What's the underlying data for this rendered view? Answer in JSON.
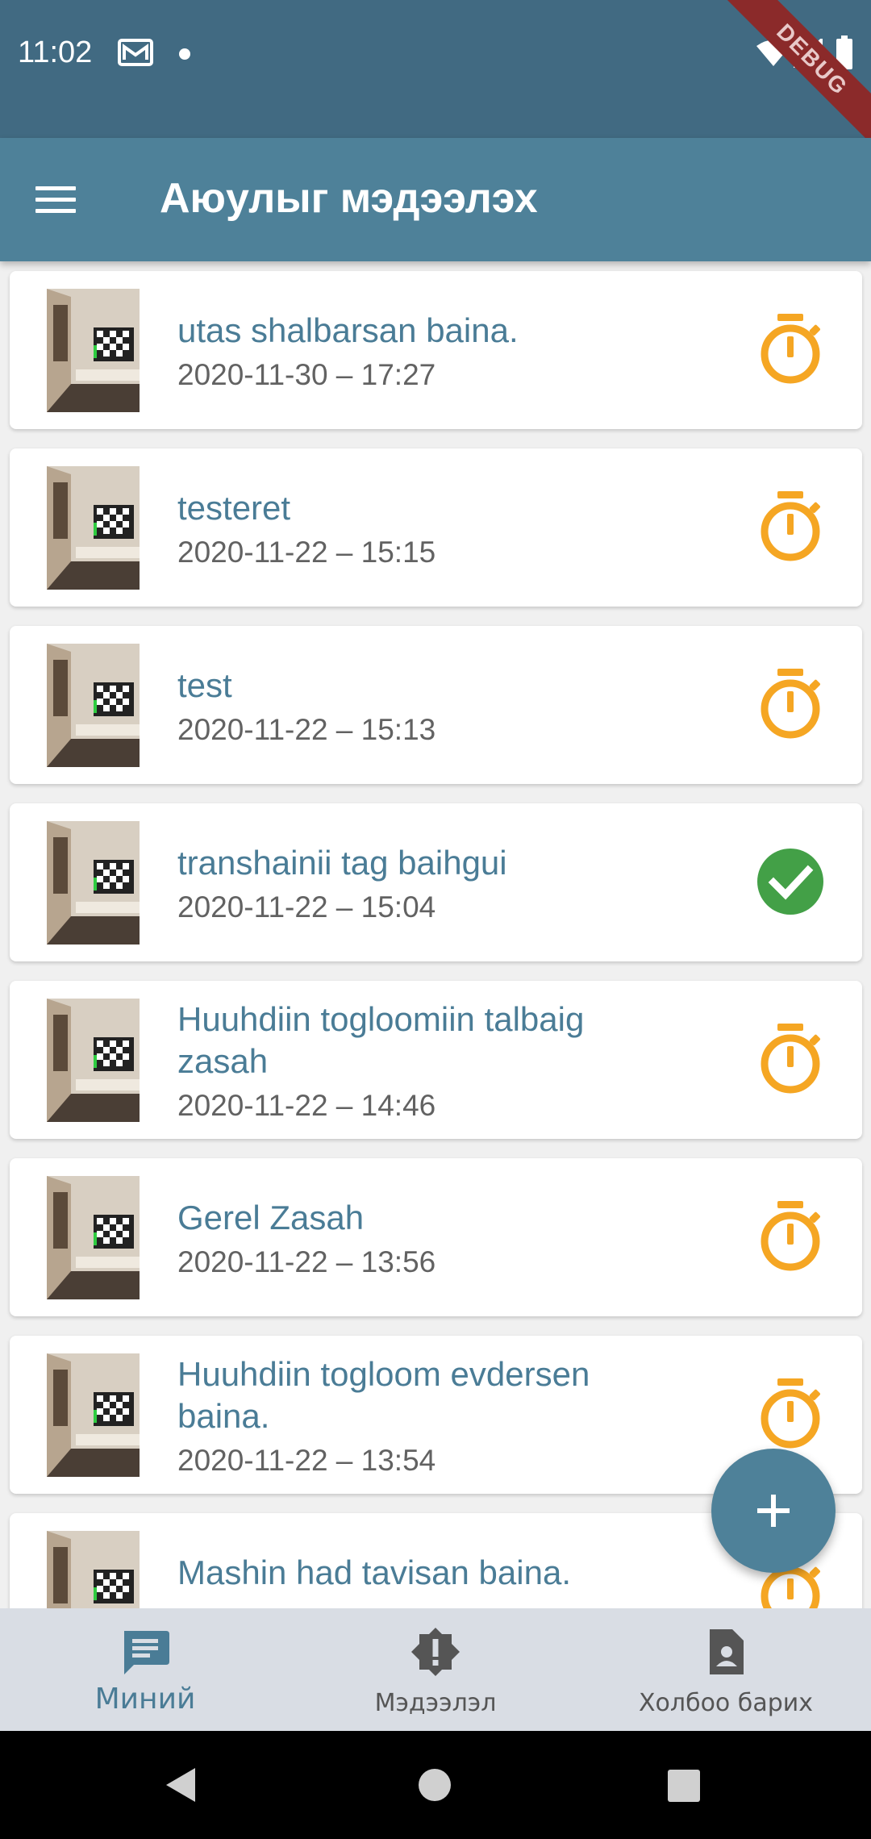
{
  "status_bar": {
    "time": "11:02",
    "debug_label": "DEBUG"
  },
  "app_bar": {
    "title": "Аюулыг мэдээлэх"
  },
  "colors": {
    "primary": "#4e8199",
    "pending": "#f5a623",
    "done": "#43a047",
    "title_text": "#4a7c96"
  },
  "reports": [
    {
      "title": "utas shalbarsan baina.",
      "date": "2020-11-30 – 17:27",
      "status": "pending",
      "status_icon": "timer-icon"
    },
    {
      "title": "testeret",
      "date": "2020-11-22 – 15:15",
      "status": "pending",
      "status_icon": "timer-icon"
    },
    {
      "title": "test",
      "date": "2020-11-22 – 15:13",
      "status": "pending",
      "status_icon": "timer-icon"
    },
    {
      "title": "transhainii tag baihgui",
      "date": "2020-11-22 – 15:04",
      "status": "done",
      "status_icon": "check-circle-icon"
    },
    {
      "title": "Huuhdiin togloomiin talbaig zasah",
      "date": "2020-11-22 – 14:46",
      "status": "pending",
      "status_icon": "timer-icon"
    },
    {
      "title": "Gerel Zasah",
      "date": "2020-11-22 – 13:56",
      "status": "pending",
      "status_icon": "timer-icon"
    },
    {
      "title": "Huuhdiin togloom evdersen baina.",
      "date": "2020-11-22 – 13:54",
      "status": "pending",
      "status_icon": "timer-icon"
    },
    {
      "title": "Mashin had tavisan baina.",
      "date": "",
      "status": "pending",
      "status_icon": "timer-icon"
    }
  ],
  "fab": {
    "icon": "plus-icon"
  },
  "bottom_nav": [
    {
      "label": "Миний",
      "icon": "chat-icon",
      "active": true
    },
    {
      "label": "Мэдээлэл",
      "icon": "alert-badge-icon",
      "active": false
    },
    {
      "label": "Холбоо барих",
      "icon": "contact-document-icon",
      "active": false
    }
  ]
}
